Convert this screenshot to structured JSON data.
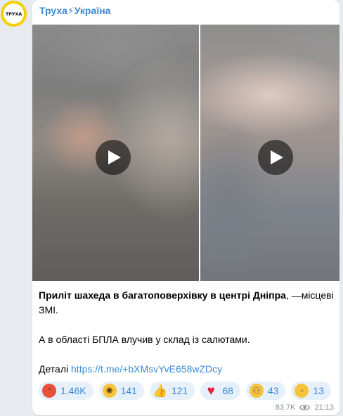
{
  "channel": {
    "name": "Труха⚡Україна",
    "avatar_text": "ТРУХА"
  },
  "media": {
    "videos": [
      {
        "label": "video-1"
      },
      {
        "label": "video-2"
      }
    ]
  },
  "post": {
    "title_bold": "Приліт шахеда в багатоповерхівку в центрі Дніпра",
    "title_rest": ", —місцеві ЗМІ.",
    "line2": "А в області БПЛА влучив у склад із салютами.",
    "details_label": "Деталі ",
    "details_link": "https://t.me/+bXMsvYvE658wZDcy"
  },
  "reactions": [
    {
      "icon": "angry-face-icon",
      "count": "1.46K"
    },
    {
      "icon": "exploding-head-icon",
      "count": "141"
    },
    {
      "icon": "thumbs-up-icon",
      "count": "121"
    },
    {
      "icon": "red-heart-icon",
      "count": "68"
    },
    {
      "icon": "screaming-face-icon",
      "count": "43"
    },
    {
      "icon": "raised-eyebrow-face-icon",
      "count": "13"
    }
  ],
  "meta": {
    "views": "83.7K",
    "time": "21:13"
  },
  "colors": {
    "accent": "#3a8ad4",
    "reaction_bg": "#e5f0fb",
    "chat_bg": "#e7ebf0",
    "avatar_ring": "#f5d000"
  }
}
